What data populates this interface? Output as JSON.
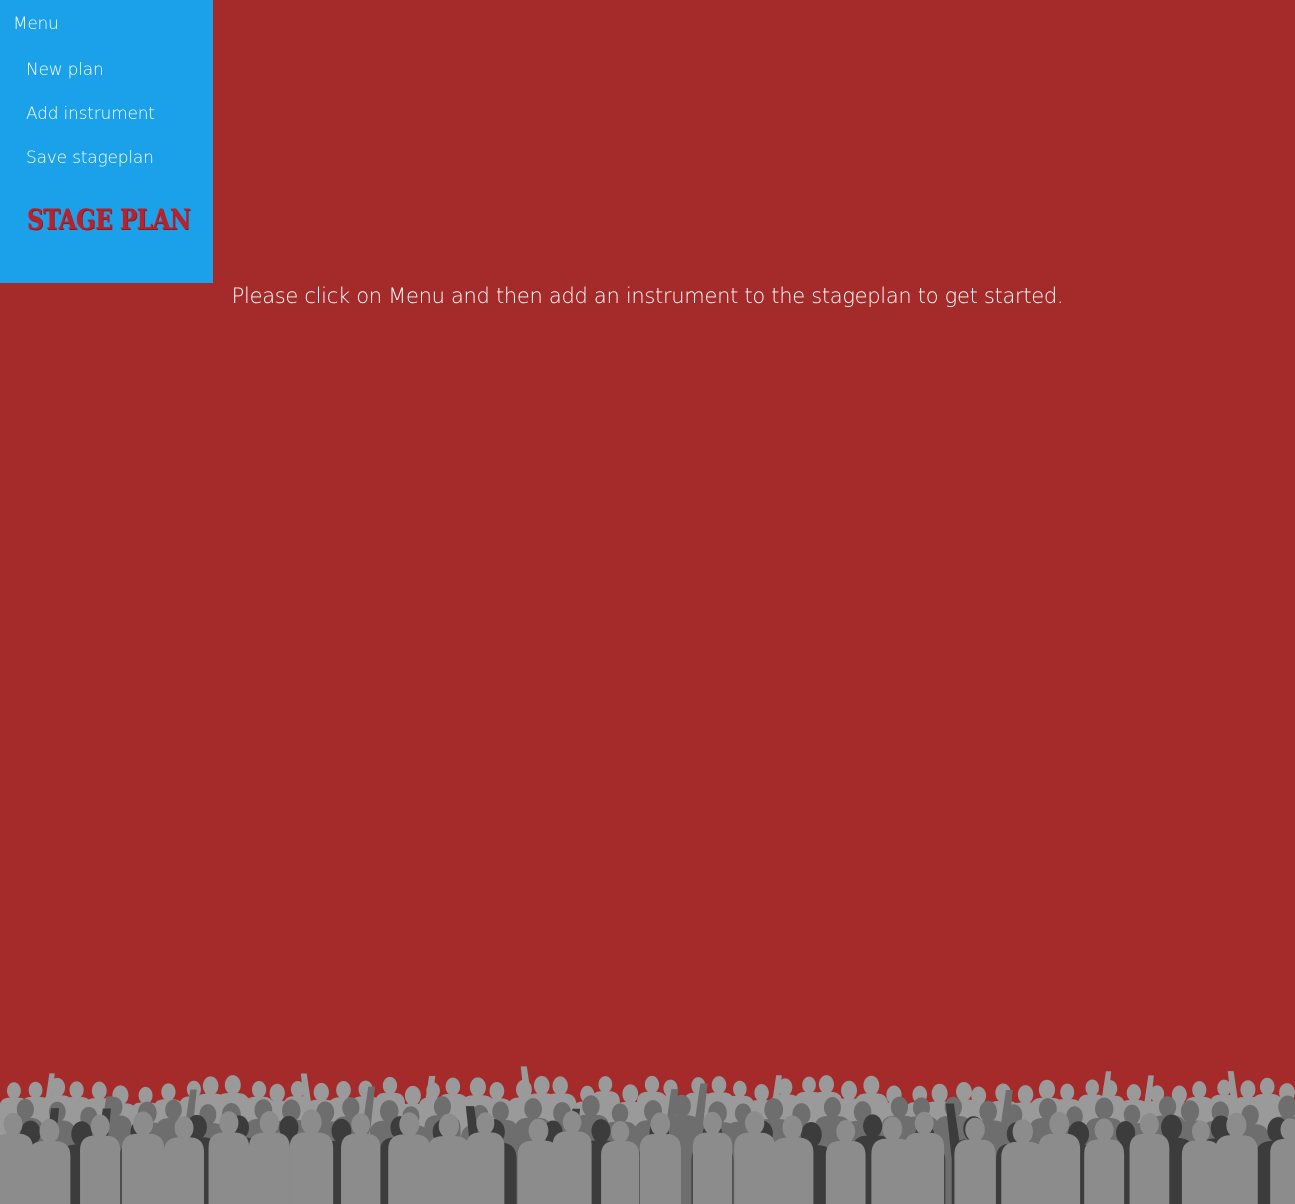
{
  "menu": {
    "title": "Menu",
    "items": [
      {
        "label": "New plan"
      },
      {
        "label": "Add instrument"
      },
      {
        "label": "Save stageplan"
      }
    ],
    "logo_text": "STAGE PLAN"
  },
  "main": {
    "hint": "Please click on Menu and then add an instrument to the stageplan to get started."
  },
  "colors": {
    "background": "#a52a2a",
    "menu_background": "#1ba1ea",
    "text": "#ffffff",
    "logo": "#b3242f"
  }
}
